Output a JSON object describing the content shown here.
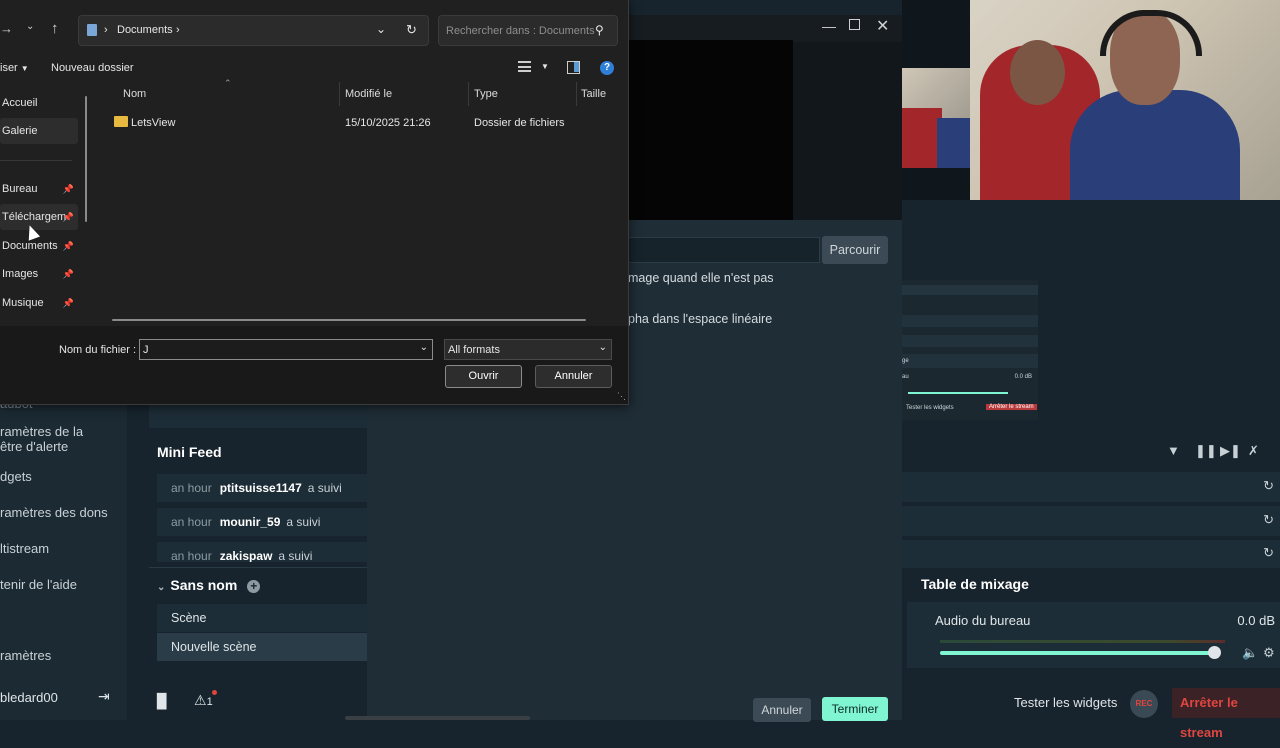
{
  "dialog": {
    "breadcrumb": {
      "folder": "Documents"
    },
    "search": {
      "placeholder": "Rechercher dans : Documents"
    },
    "toolbar": {
      "organize": "iser",
      "new_folder": "Nouveau dossier"
    },
    "nav": [
      {
        "label": "Accueil",
        "pinned": false
      },
      {
        "label": "Galerie",
        "pinned": false
      },
      {
        "label": "Bureau",
        "pinned": true
      },
      {
        "label": "Téléchargem",
        "pinned": true
      },
      {
        "label": "Documents",
        "pinned": true
      },
      {
        "label": "Images",
        "pinned": true
      },
      {
        "label": "Musique",
        "pinned": true
      }
    ],
    "columns": {
      "name": "Nom",
      "modified": "Modifié le",
      "type": "Type",
      "size": "Taille"
    },
    "files": [
      {
        "name": "LetsView",
        "modified": "15/10/2025 21:26",
        "type": "Dossier de fichiers"
      }
    ],
    "filename_label": "Nom du fichier :",
    "filename_value": "J",
    "filetype": "All formats",
    "open_button": "Ouvrir",
    "cancel_button": "Annuler"
  },
  "app": {
    "modal": {
      "browse_button": "Parcourir",
      "option1": "mage quand elle n'est pas",
      "option2": "pha dans l'espace linéaire",
      "cancel": "Annuler",
      "finish": "Terminer"
    },
    "sidebar": [
      "aubot",
      "ramètres de la",
      "être d'alerte",
      "dgets",
      "ramètres des dons",
      "ltistream",
      "tenir de l'aide",
      "ramètres"
    ],
    "user": "bledard00",
    "feed": {
      "title": "Mini Feed",
      "rows": [
        {
          "time": "an hour",
          "user": "ptitsuisse1147",
          "action": "a suivi"
        },
        {
          "time": "an hour",
          "user": "mounir_59",
          "action": "a suivi"
        },
        {
          "time": "an hour",
          "user": "zakispaw",
          "action": "a suivi"
        }
      ]
    },
    "scenes": {
      "title": "Sans nom",
      "items": [
        "Scène",
        "Nouvelle scène"
      ]
    },
    "mixer": {
      "title": "Table de mixage",
      "source": "Audio du bureau",
      "level": "0.0 dB",
      "volume_fraction": 0.98
    },
    "footer": {
      "test_widgets": "Tester les widgets",
      "rec": "REC",
      "stop_stream": "Arrêter le stream"
    },
    "mini_preview": {
      "level": "0.0 dB",
      "test_widgets": "Tester les widgets",
      "stop_stream": "Arrêter le stream",
      "row_label_1": "ge",
      "row_label_2": "au"
    },
    "notification_count": "1"
  },
  "colors": {
    "accent": "#80f5d2",
    "danger": "#e0453f",
    "dialog_bg": "#202020",
    "app_bg": "#17242d"
  }
}
